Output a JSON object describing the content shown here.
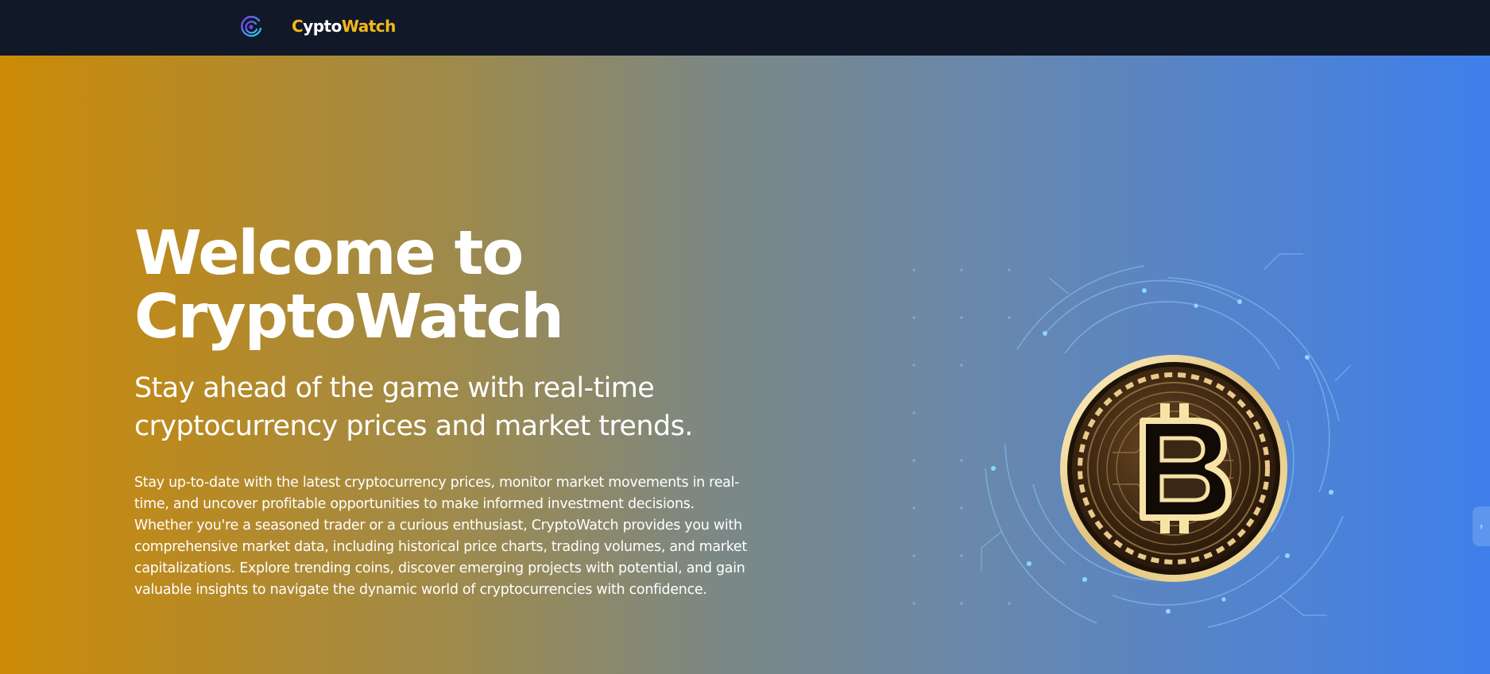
{
  "brand": {
    "logo_icon": "orbit-logo-icon",
    "name_first": "C",
    "name_mid": "ypto",
    "name_end": "Watch",
    "accent": "#F5B81B"
  },
  "hero": {
    "title": "Welcome to CryptoWatch",
    "subtitle": "Stay ahead of the game with real-time cryptocurrency prices and market trends.",
    "description": "Stay up-to-date with the latest cryptocurrency prices, monitor market movements in real-time, and uncover profitable opportunities to make informed investment decisions. Whether you're a seasoned trader or a curious enthusiast, CryptoWatch provides you with comprehensive market data, including historical price charts, trading volumes, and market capitalizations. Explore trending coins, discover emerging projects with potential, and gain valuable insights to navigate the dynamic world of cryptocurrencies with confidence.",
    "image_icon": "bitcoin-coin-icon",
    "gradient_start": "#CC8A06",
    "gradient_end": "#3E7FEC"
  },
  "side_tab": {
    "glyph": "›",
    "icon": "chevron-right-icon"
  }
}
